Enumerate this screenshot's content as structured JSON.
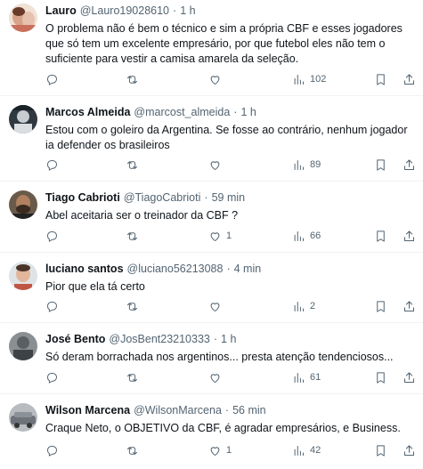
{
  "tweets": [
    {
      "name": "Lauro",
      "handle": "@Lauro19028610",
      "dot": "·",
      "time": "1 h",
      "text": "O problema não é bem o técnico e sim a própria CBF e esses jogadores que só tem um excelente empresário, por que futebol eles não tem o suficiente para vestir a camisa amarela da seleção.",
      "replies": "",
      "retweets": "",
      "likes": "",
      "views": "102"
    },
    {
      "name": "Marcos Almeida",
      "handle": "@marcost_almeida",
      "dot": "·",
      "time": "1 h",
      "text": "Estou com o goleiro da Argentina. Se fosse ao contrário, nenhum jogador ia defender os brasileiros",
      "replies": "",
      "retweets": "",
      "likes": "",
      "views": "89"
    },
    {
      "name": "Tiago Cabrioti",
      "handle": "@TiagoCabrioti",
      "dot": "·",
      "time": "59 min",
      "text": "Abel aceitaria ser o treinador da CBF ?",
      "replies": "",
      "retweets": "",
      "likes": "1",
      "views": "66"
    },
    {
      "name": "luciano santos",
      "handle": "@luciano56213088",
      "dot": "·",
      "time": "4 min",
      "text": "Pior que ela tá certo",
      "replies": "",
      "retweets": "",
      "likes": "",
      "views": "2"
    },
    {
      "name": "José Bento",
      "handle": "@JosBent23210333",
      "dot": "·",
      "time": "1 h",
      "text": "Só deram borrachada nos argentinos... presta atenção tendenciosos...",
      "replies": "",
      "retweets": "",
      "likes": "",
      "views": "61"
    },
    {
      "name": "Wilson Marcena",
      "handle": "@WilsonMarcena",
      "dot": "·",
      "time": "56 min",
      "text": "Craque Neto, o OBJETIVO da CBF, é agradar empresários, e Business.",
      "replies": "",
      "retweets": "",
      "likes": "1",
      "views": "42"
    }
  ],
  "icons": {
    "reply": "reply-icon",
    "retweet": "retweet-icon",
    "like": "heart-icon",
    "views": "views-icon",
    "bookmark": "bookmark-icon",
    "share": "share-icon"
  },
  "colors": {
    "text": "#0f1419",
    "secondary": "#536471",
    "divider": "#eff3f4"
  }
}
